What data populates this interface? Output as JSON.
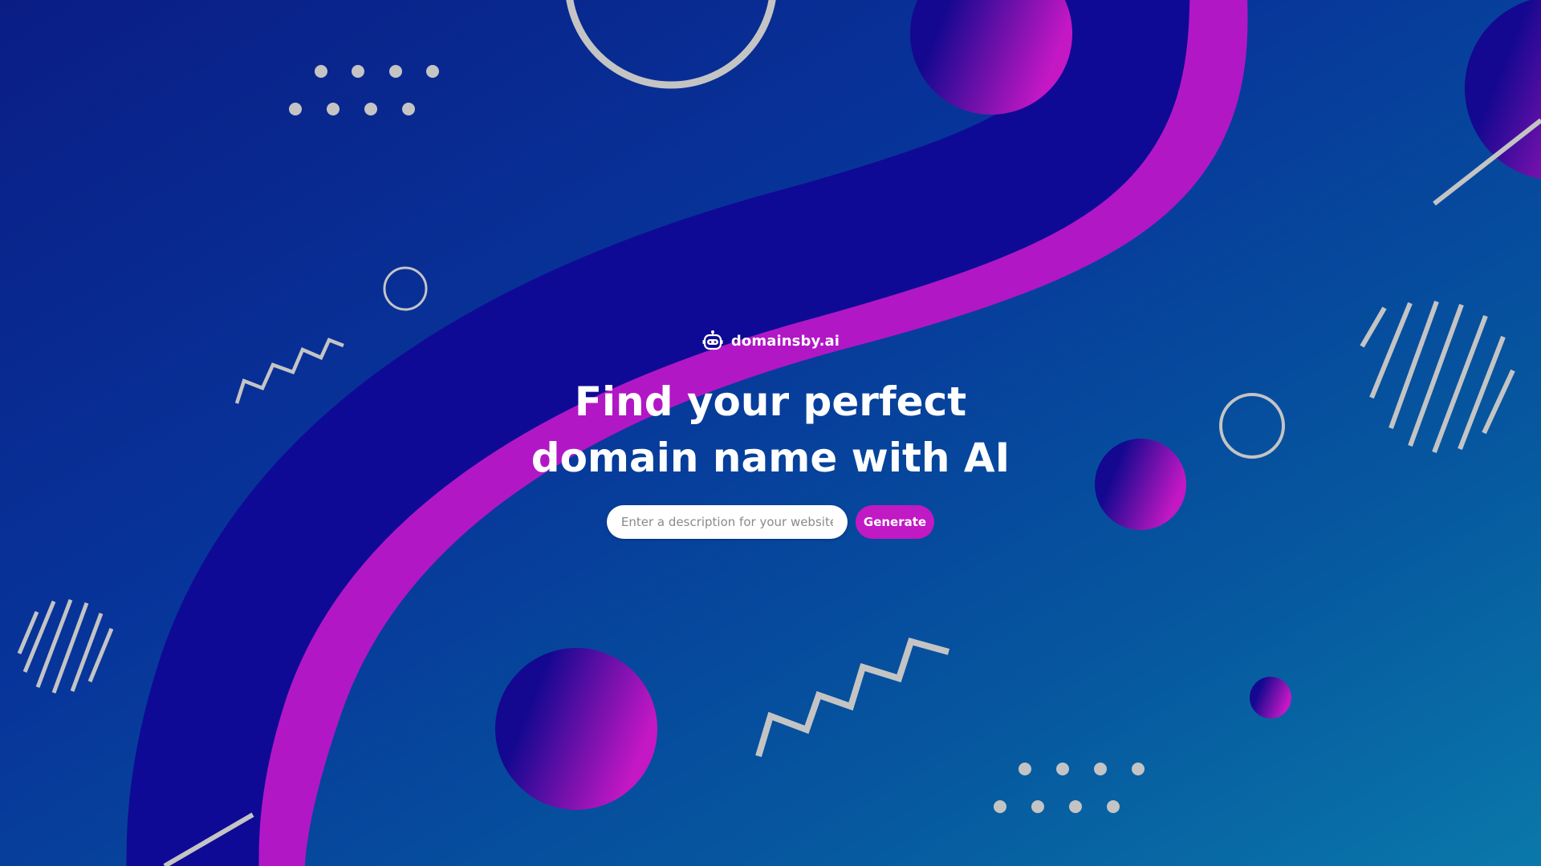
{
  "brand": {
    "icon": "robot-icon",
    "name": "domainsby.ai"
  },
  "hero": {
    "title_line1": "Find your perfect",
    "title_line2": "domain name with AI"
  },
  "search": {
    "placeholder": "Enter a description for your website",
    "value": "",
    "button_label": "Generate"
  },
  "colors": {
    "background_start": "#0a1d86",
    "background_end": "#0a78aa",
    "wave_dark": "#110a95",
    "wave_accent": "#b616c8",
    "button": "#c119c4",
    "shape_outline": "#c4c4c4"
  }
}
